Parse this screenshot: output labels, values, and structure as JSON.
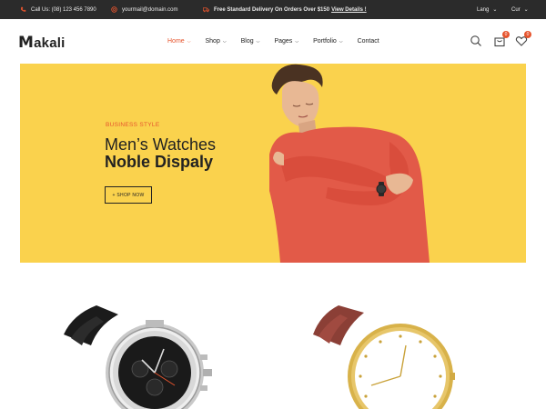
{
  "topbar": {
    "phone_icon": "phone-icon",
    "phone": "Call Us: (08) 123 456 7890",
    "email_icon": "mail-icon",
    "email": "yourmail@domain.com",
    "promo_icon": "truck-icon",
    "promo_text": "Free Standard Delivery On Orders Over $150",
    "promo_link": "View Details !",
    "lang": "Lang",
    "currency": "Cur"
  },
  "header": {
    "logo_mark": "M",
    "logo_rest": "akali",
    "nav": [
      {
        "label": "Home",
        "active": true,
        "dropdown": true
      },
      {
        "label": "Shop",
        "active": false,
        "dropdown": true
      },
      {
        "label": "Blog",
        "active": false,
        "dropdown": true
      },
      {
        "label": "Pages",
        "active": false,
        "dropdown": true
      },
      {
        "label": "Portfolio",
        "active": false,
        "dropdown": true
      },
      {
        "label": "Contact",
        "active": false,
        "dropdown": false
      }
    ],
    "cart_count": "0",
    "wishlist_count": "0"
  },
  "hero": {
    "eyebrow": "BUSINESS STYLE",
    "title_line1": "Men’s Watches",
    "title_line2": "Noble Dispaly",
    "cta": "+ SHOP NOW"
  },
  "colors": {
    "accent": "#e6542d",
    "hero_bg": "#fad24d",
    "topbar_bg": "#2b2b2b"
  }
}
